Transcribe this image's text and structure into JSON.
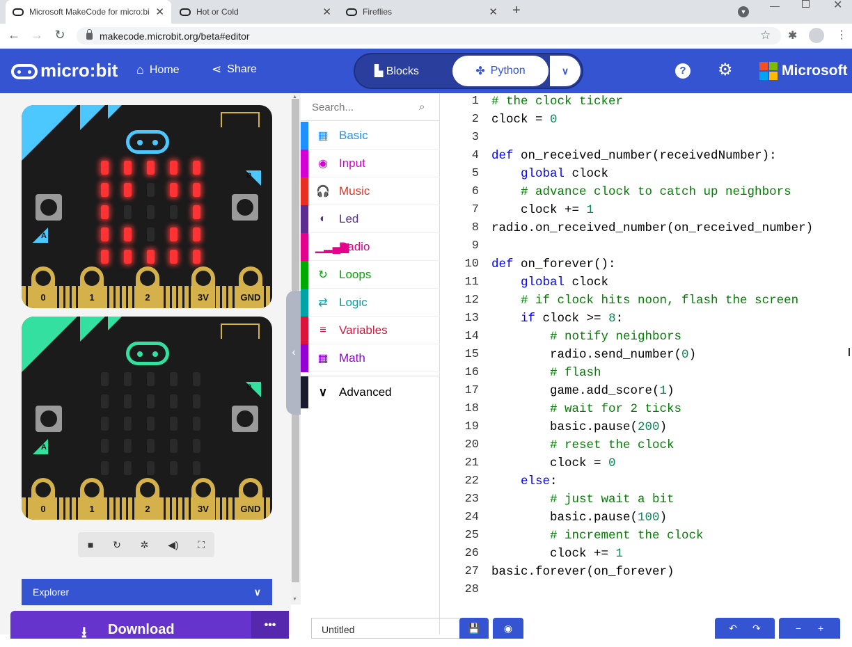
{
  "browser": {
    "tabs": [
      {
        "title": "Microsoft MakeCode for micro:bi",
        "active": true
      },
      {
        "title": "Hot or Cold",
        "active": false
      },
      {
        "title": "Fireflies",
        "active": false
      }
    ],
    "url": "makecode.microbit.org/beta#editor"
  },
  "header": {
    "brand": "micro:bit",
    "home": "Home",
    "share": "Share",
    "mode_blocks": "Blocks",
    "mode_python": "Python",
    "microsoft": "Microsoft"
  },
  "simulator": {
    "boards": [
      {
        "accent": "#4dc8ff",
        "pattern": [
          [
            1,
            1,
            1,
            1,
            1
          ],
          [
            1,
            1,
            0,
            1,
            1
          ],
          [
            1,
            0,
            0,
            0,
            1
          ],
          [
            1,
            1,
            0,
            1,
            1
          ],
          [
            1,
            1,
            1,
            1,
            1
          ]
        ]
      },
      {
        "accent": "#33e0a0",
        "pattern": [
          [
            0,
            0,
            0,
            0,
            0
          ],
          [
            0,
            0,
            0,
            0,
            0
          ],
          [
            0,
            0,
            0,
            0,
            0
          ],
          [
            0,
            0,
            0,
            0,
            0
          ],
          [
            0,
            0,
            0,
            0,
            0
          ]
        ]
      }
    ],
    "pin_labels": [
      "0",
      "1",
      "2",
      "3V",
      "GND"
    ],
    "button_a": "A",
    "button_b": "B",
    "explorer": "Explorer",
    "download": "Download"
  },
  "toolbox": {
    "search_placeholder": "Search...",
    "categories": [
      {
        "label": "Basic",
        "color": "#1e90ff",
        "icon": "▦"
      },
      {
        "label": "Input",
        "color": "#d400d4",
        "icon": "◉"
      },
      {
        "label": "Music",
        "color": "#e63022",
        "icon": "🎧"
      },
      {
        "label": "Led",
        "color": "#5c2d91",
        "icon": "◐"
      },
      {
        "label": "Radio",
        "color": "#e3008c",
        "icon": "▁▂▄▆"
      },
      {
        "label": "Loops",
        "color": "#00aa00",
        "icon": "↻"
      },
      {
        "label": "Logic",
        "color": "#00a4a6",
        "icon": "⇄"
      },
      {
        "label": "Variables",
        "color": "#dc143c",
        "icon": "≡"
      },
      {
        "label": "Math",
        "color": "#9400d3",
        "icon": "▦"
      }
    ],
    "advanced": "Advanced"
  },
  "editor": {
    "lines": [
      "# the clock ticker",
      "clock = 0",
      "",
      "def on_received_number(receivedNumber):",
      "    global clock",
      "    # advance clock to catch up neighbors",
      "    clock += 1",
      "radio.on_received_number(on_received_number)",
      "",
      "def on_forever():",
      "    global clock",
      "    # if clock hits noon, flash the screen",
      "    if clock >= 8:",
      "        # notify neighbors",
      "        radio.send_number(0)",
      "        # flash",
      "        game.add_score(1)",
      "        # wait for 2 ticks",
      "        basic.pause(200)",
      "        # reset the clock",
      "        clock = 0",
      "    else:",
      "        # just wait a bit",
      "        basic.pause(100)",
      "        # increment the clock",
      "        clock += 1",
      "basic.forever(on_forever)",
      ""
    ]
  },
  "bottom": {
    "project_name": "Untitled"
  }
}
